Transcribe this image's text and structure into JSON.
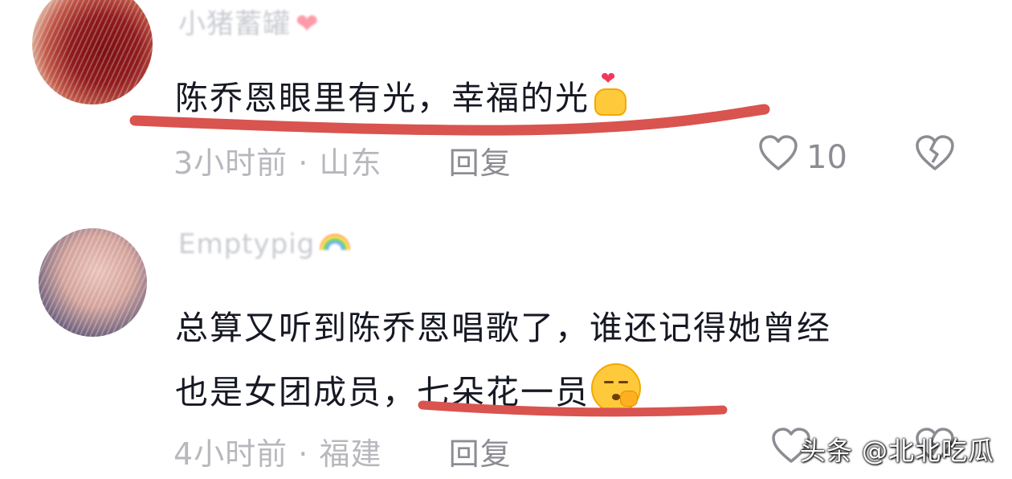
{
  "comments": [
    {
      "username": "小猪蓄罐",
      "username_emoji": "❤",
      "text": "陈乔恩眼里有光，幸福的光",
      "time": "3小时前",
      "location": "山东",
      "separator": "·",
      "reply_label": "回复",
      "like_count": "10"
    },
    {
      "username": "Emptypig",
      "text_line1": "总算又听到陈乔恩唱歌了，谁还记得她曾经",
      "text_line2": "也是女团成员，七朵花一员",
      "time": "4小时前",
      "location": "福建",
      "separator": "·",
      "reply_label": "回复",
      "like_count": ""
    }
  ],
  "watermark": "头条 @北北吃瓜",
  "colors": {
    "underline": "#d9534f",
    "meta_text": "#b7b8bd",
    "primary_text": "#161823"
  },
  "icons": {
    "like": "heart-outline-icon",
    "dislike": "broken-heart-icon"
  }
}
